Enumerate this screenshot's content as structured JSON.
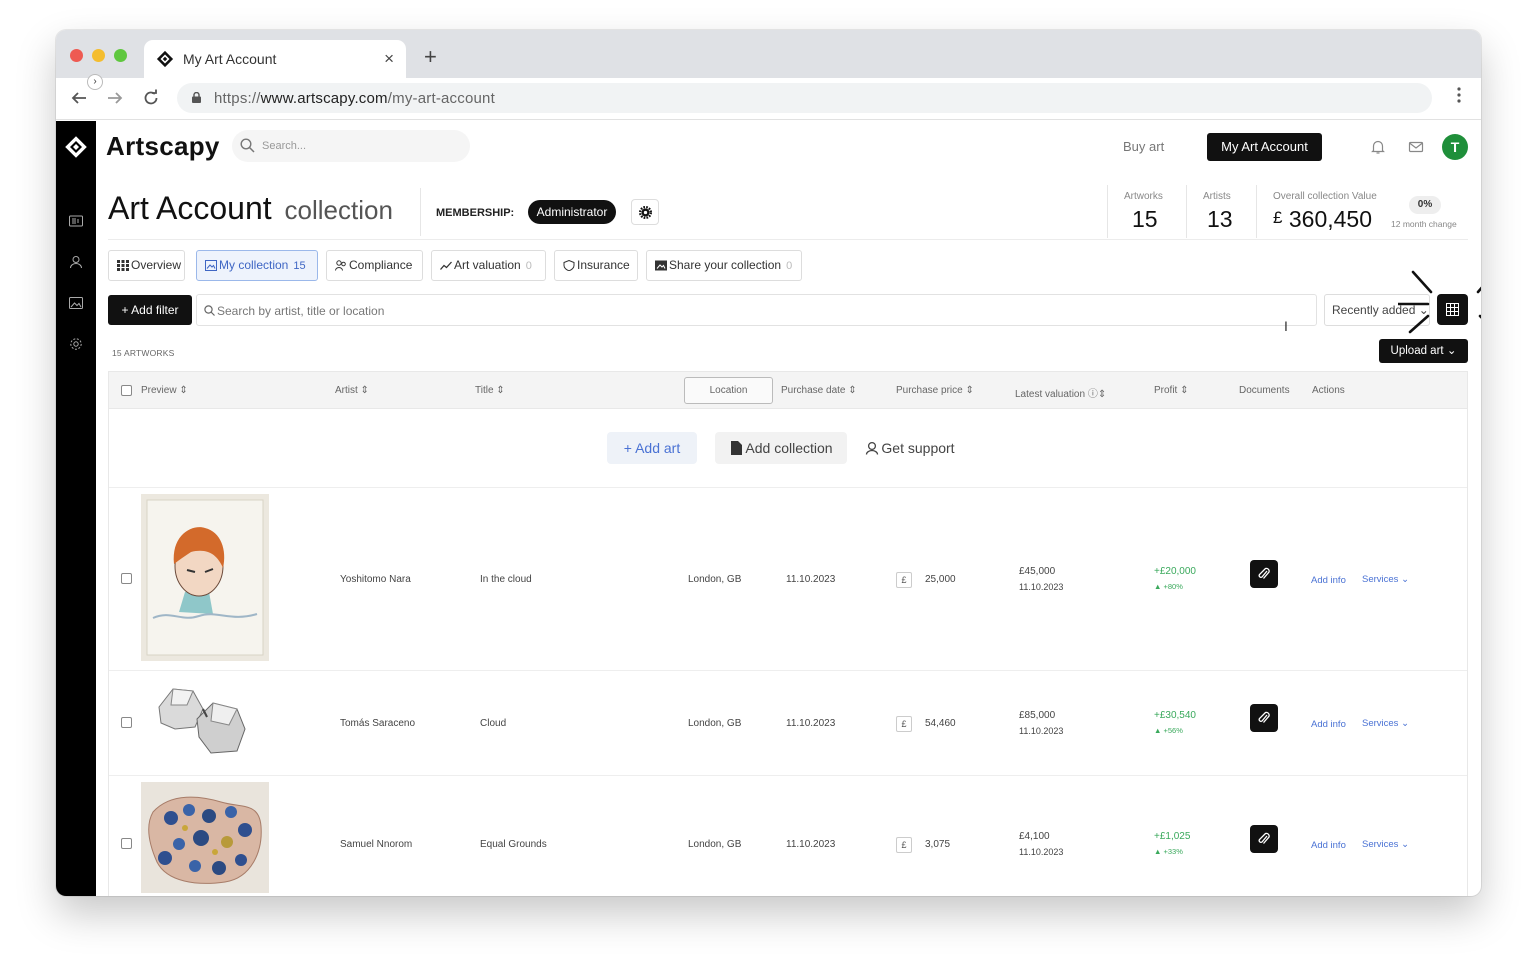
{
  "browser": {
    "tab_title": "My Art Account",
    "close_glyph": "×",
    "new_tab_glyph": "+",
    "url_scheme": "https://",
    "url_host": "www.artscapy.com",
    "url_path": "/my-art-account"
  },
  "header": {
    "brand": "Artscapy",
    "search_placeholder": "Search...",
    "buy_art": "Buy art",
    "my_account": "My Art Account",
    "avatar_initial": "T"
  },
  "page": {
    "title": "Art Account",
    "subtitle": "collection",
    "membership_label": "MEMBERSHIP:",
    "membership_value": "Administrator"
  },
  "stats": {
    "artworks_label": "Artworks",
    "artworks_value": "15",
    "artists_label": "Artists",
    "artists_value": "13",
    "value_label": "Overall collection Value",
    "value_currency": "£",
    "value_amount": "360,450",
    "change_badge": "0%",
    "change_note": "12 month change"
  },
  "tabs": [
    {
      "label": "Overview",
      "count": "",
      "icon": "grid-icon"
    },
    {
      "label": "My collection",
      "count": "15",
      "icon": "gallery-icon"
    },
    {
      "label": "Compliance",
      "count": "",
      "icon": "users-icon"
    },
    {
      "label": "Art valuation",
      "count": "0",
      "icon": "trend-icon"
    },
    {
      "label": "Insurance",
      "count": "",
      "icon": "shield-icon"
    },
    {
      "label": "Share your collection",
      "count": "0",
      "icon": "image-icon"
    }
  ],
  "filters": {
    "add_filter": "+ Add filter",
    "search_placeholder": "Search by artist, title or location",
    "sort_value": "Recently added",
    "artworks_count": "15 ARTWORKS",
    "upload": "Upload art"
  },
  "table": {
    "columns": {
      "preview": "Preview ⇕",
      "artist": "Artist ⇕",
      "title": "Title ⇕",
      "location": "Location",
      "purchase_date": "Purchase date ⇕",
      "purchase_price": "Purchase price ⇕",
      "latest_valuation": "Latest valuation ⓘ⇕",
      "profit": "Profit ⇕",
      "documents": "Documents",
      "actions": "Actions"
    },
    "empty_actions": {
      "add_art": "+ Add art",
      "add_collection": "Add collection",
      "get_support": "Get support"
    },
    "rows": [
      {
        "artist": "Yoshitomo Nara",
        "title": "In the cloud",
        "location": "London, GB",
        "purchase_date": "11.10.2023",
        "currency": "£",
        "price": "25,000",
        "valuation": "£45,000",
        "valuation_date": "11.10.2023",
        "profit": "+£20,000",
        "profit_pct": "▲ +80%",
        "add_info": "Add info",
        "services": "Services ⌄"
      },
      {
        "artist": "Tomás Saraceno",
        "title": "Cloud",
        "location": "London, GB",
        "purchase_date": "11.10.2023",
        "currency": "£",
        "price": "54,460",
        "valuation": "£85,000",
        "valuation_date": "11.10.2023",
        "profit": "+£30,540",
        "profit_pct": "▲ +56%",
        "add_info": "Add info",
        "services": "Services ⌄"
      },
      {
        "artist": "Samuel Nnorom",
        "title": "Equal Grounds",
        "location": "London, GB",
        "purchase_date": "11.10.2023",
        "currency": "£",
        "price": "3,075",
        "valuation": "£4,100",
        "valuation_date": "11.10.2023",
        "profit": "+£1,025",
        "profit_pct": "▲ +33%",
        "add_info": "Add info",
        "services": "Services ⌄"
      }
    ]
  },
  "colors": {
    "accent": "#3f66c4",
    "profit": "#3aa95c",
    "avatar": "#1f8f3a",
    "dark": "#111111"
  }
}
